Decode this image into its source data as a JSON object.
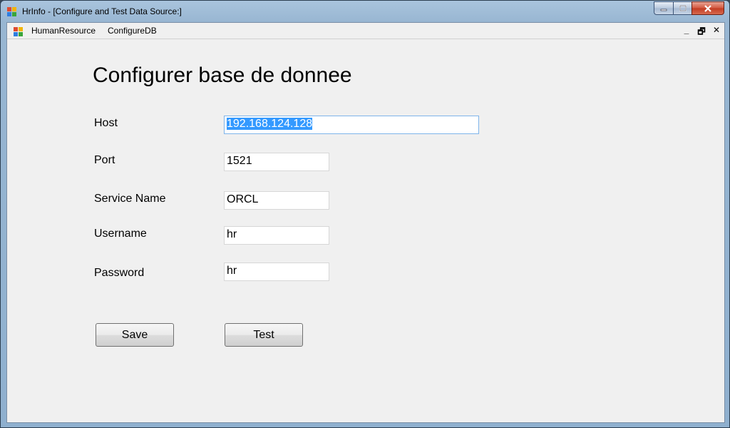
{
  "window": {
    "title": "HrInfo - [Configure and Test Data Source:]"
  },
  "menu": {
    "items": [
      "HumanResource",
      "ConfigureDB"
    ]
  },
  "mdi_controls": {
    "minimize": "_",
    "restore": "🗗",
    "close": "✕"
  },
  "form": {
    "heading": "Configurer base de donnee",
    "fields": [
      {
        "label": "Host",
        "value": "192.168.124.128"
      },
      {
        "label": "Port",
        "value": "1521"
      },
      {
        "label": "Service Name",
        "value": "ORCL"
      },
      {
        "label": "Username",
        "value": "hr"
      },
      {
        "label": "Password",
        "value": "hr"
      }
    ],
    "save_label": "Save",
    "test_label": "Test"
  },
  "colors": {
    "selection": "#3399ff",
    "form_background": "#f0f0f0"
  }
}
